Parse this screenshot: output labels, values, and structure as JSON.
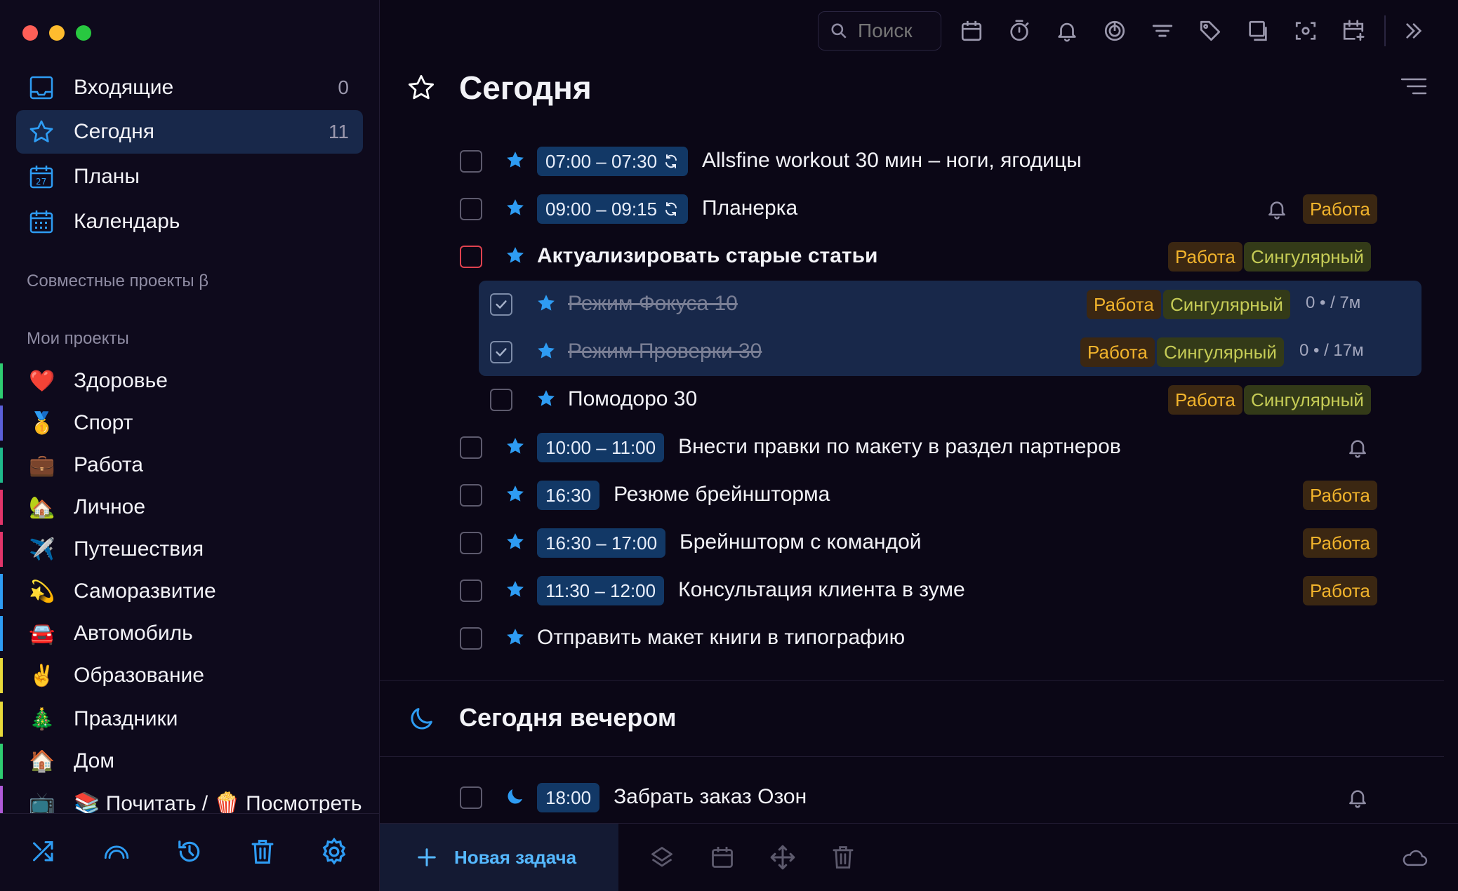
{
  "colors": {
    "accent": "#2e9cf3",
    "work_tag_text": "#f2b42c",
    "singular_tag_text": "#c6cc56",
    "selection_bg": "#18284a"
  },
  "search": {
    "placeholder": "Поиск"
  },
  "sidebar": {
    "nav": [
      {
        "label": "Входящие",
        "count": "0",
        "icon": "inbox-icon"
      },
      {
        "label": "Сегодня",
        "count": "11",
        "icon": "star-icon"
      },
      {
        "label": "Планы",
        "count": "",
        "icon": "calendar-27-icon"
      },
      {
        "label": "Календарь",
        "count": "",
        "icon": "calendar-grid-icon"
      }
    ],
    "shared_projects": "Совместные проекты β",
    "my_projects": "Мои проекты",
    "projects": [
      {
        "emoji": "❤️",
        "label": "Здоровье",
        "color": "#2ecc71"
      },
      {
        "emoji": "🥇",
        "label": "Спорт",
        "color": "#5a5fd8"
      },
      {
        "emoji": "💼",
        "label": "Работа",
        "color": "#1fb98b"
      },
      {
        "emoji": "🏡",
        "label": "Личное",
        "color": "#e2356a"
      },
      {
        "emoji": "✈️",
        "label": "Путешествия",
        "color": "#e2356a"
      },
      {
        "emoji": "💫",
        "label": "Саморазвитие",
        "color": "#2e9cf3"
      },
      {
        "emoji": "🚘",
        "label": "Автомобиль",
        "color": "#2e9cf3"
      },
      {
        "emoji": "✌️",
        "label": "Образование",
        "color": "#e8d93a"
      },
      {
        "emoji": "🎄",
        "label": "Праздники",
        "color": "#e8d93a"
      },
      {
        "emoji": "🏠",
        "label": "Дом",
        "color": "#2ecc71"
      },
      {
        "emoji": "📺",
        "label": "📚 Почитать / 🍿 Посмотреть",
        "color": "#b05ad8"
      }
    ]
  },
  "today": {
    "title": "Сегодня",
    "tasks": [
      {
        "time": "07:00 – 07:30",
        "title": "Allsfine workout 30 мин – ноги, ягодицы"
      },
      {
        "time": "09:00 – 09:15",
        "title": "Планерка",
        "tag": "Работа"
      },
      {
        "title": "Актуализировать старые статьи",
        "tags": [
          "Работа",
          "Сингулярный"
        ]
      },
      {
        "title": "Режим Фокуса 10",
        "tags": [
          "Работа",
          "Сингулярный"
        ],
        "pomo": "0 • / 7м"
      },
      {
        "title": "Режим Проверки 30",
        "tags": [
          "Работа",
          "Сингулярный"
        ],
        "pomo": "0 • / 17м"
      },
      {
        "title": "Помодоро 30",
        "tags": [
          "Работа",
          "Сингулярный"
        ]
      },
      {
        "time": "10:00 – 11:00",
        "title": "Внести правки по макету в раздел партнеров"
      },
      {
        "time": "16:30",
        "title": "Резюме брейншторма",
        "tag": "Работа"
      },
      {
        "time": "16:30 – 17:00",
        "title": "Брейншторм с командой",
        "tag": "Работа"
      },
      {
        "time": "11:30 – 12:00",
        "title": "Консультация клиента в зуме",
        "tag": "Работа"
      },
      {
        "title": "Отправить макет книги в типографию"
      }
    ]
  },
  "evening": {
    "title": "Сегодня вечером",
    "tasks": [
      {
        "time": "18:00",
        "title": "Забрать заказ Озон"
      }
    ]
  },
  "footer": {
    "new_task": "Новая задача"
  }
}
